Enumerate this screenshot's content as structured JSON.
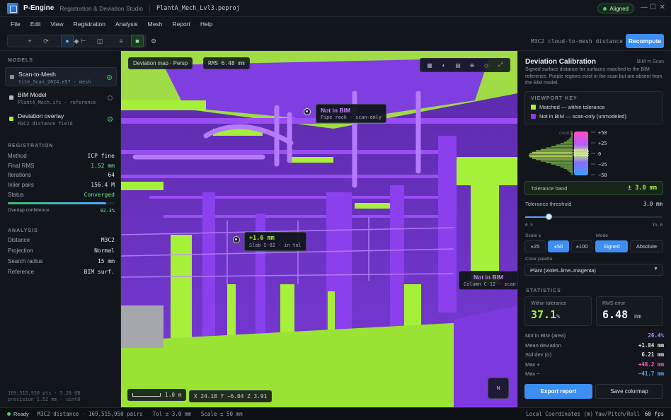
{
  "app": {
    "name": "P-Engine",
    "subtitle": "Registration & Deviation Studio",
    "file": "PlantA_Mech_Lvl3.peproj",
    "status_badge": "Aligned",
    "colors": {
      "accent": "#3d8ef0",
      "match": "#a6f03a",
      "missing": "#8c3cf0",
      "ok": "#4ad46a"
    }
  },
  "window_controls": {
    "minimize": "—",
    "maximize": "☐",
    "close": "✕"
  },
  "menu": [
    "File",
    "Edit",
    "View",
    "Registration",
    "Analysis",
    "Mesh",
    "Report",
    "Help"
  ],
  "toolbar": {
    "icons": [
      "select-icon",
      "move-icon",
      "rotate-icon",
      "point-icon",
      "measure-icon",
      "section-icon",
      "layers-icon",
      "mesh-icon",
      "settings-icon"
    ],
    "glyphs": [
      "◆",
      "+",
      "⟳",
      "●",
      "⊢",
      "◫",
      "≡",
      "■",
      "⚙"
    ],
    "metric": "M3C2 cloud-to-mesh distance",
    "recompute": "Recompute"
  },
  "left": {
    "models_title": "MODELS",
    "models": [
      {
        "name": "Scan-to-Mesh",
        "meta": "Site_Scan_2024.e57 · mesh",
        "color": "#8a8f96",
        "active": true
      },
      {
        "name": "BIM Model",
        "meta": "PlantA_Mech.ifc · reference",
        "color": "#b7bcc3",
        "active": false
      },
      {
        "name": "Deviation overlay",
        "meta": "M3C2 distance field",
        "color": "#a6f03a",
        "active": true
      }
    ],
    "registration_title": "REGISTRATION",
    "registration": [
      {
        "k": "Method",
        "v": "ICP fine"
      },
      {
        "k": "Final RMS",
        "v": "1.52 mm",
        "hl": true
      },
      {
        "k": "Iterations",
        "v": "64"
      },
      {
        "k": "Inlier pairs",
        "v": "156.4 M"
      },
      {
        "k": "Status",
        "v": "Converged",
        "hl": true
      }
    ],
    "overlap_label": "Overlap confidence",
    "overlap_value": "92.3%",
    "overlap_fraction": 0.923,
    "analysis_title": "ANALYSIS",
    "analysis": [
      {
        "k": "Distance",
        "v": "M3C2"
      },
      {
        "k": "Projection",
        "v": "Normal"
      },
      {
        "k": "Search radius",
        "v": "15 mm"
      },
      {
        "k": "Reference",
        "v": "BIM surf."
      }
    ],
    "footer1": "169,515,950 pts · 5.28 GB",
    "footer2": "precision 1.52 mm · uint8"
  },
  "viewport": {
    "mode": "Deviation map · Persp",
    "rms": "RMS 6.48 mm",
    "tool_glyphs": [
      "▦",
      "◐",
      "▤",
      "⊕",
      "◇",
      "⤢"
    ],
    "callout1": {
      "title": "Not in BIM",
      "sub": "Pipe rack · scan-only"
    },
    "callout2": {
      "title": "+1.6 mm",
      "sub": "Slab S-02 · in tol"
    },
    "callout3": {
      "title": "Not in BIM",
      "sub": "Column C-12 · scan-only"
    },
    "scale": "1.0 m",
    "coords": "X 24.18  Y −6.04  Z 3.91",
    "compass": "N"
  },
  "right": {
    "title": "Deviation Calibration",
    "mode": "BIM ⇆ Scan",
    "desc": "Signed surface distance for surfaces matched to the BIM reference. Purple regions exist in the scan but are absent from the BIM model.",
    "key_title": "VIEWPORT KEY",
    "key": [
      {
        "label": "Matched — within tolerance",
        "color": "#a6f03a"
      },
      {
        "label": "Not in BIM — scan-only (unmodeled)",
        "color": "#8c3cf0"
      }
    ],
    "hist_label": "count",
    "ticks": [
      "+50",
      "+25",
      "0",
      "−25",
      "−50"
    ],
    "tol_band_label": "Tolerance band",
    "tol_band_value": "± 3.0 mm",
    "threshold_label": "Tolerance threshold",
    "threshold_value": "3.0 mm",
    "threshold_min": "0.5",
    "threshold_max": "15.0",
    "threshold_fraction": 0.172,
    "scale_label": "Scale ±",
    "scales": [
      "±25",
      "±50",
      "±100"
    ],
    "scale_selected": 1,
    "mode_label": "Mode",
    "modes": [
      "Signed",
      "Absolute"
    ],
    "mode_selected": 0,
    "palette_label": "Color palette",
    "palette": "Plant (violet–lime–magenta)",
    "stats_title": "STATISTICS",
    "within_label": "Within tolerance",
    "within_value": "37.1",
    "within_unit": "%",
    "rms_label": "RMS error",
    "rms_value": "6.48",
    "rms_unit": "mm",
    "stats": [
      {
        "k": "Not in BIM (area)",
        "v": "26.4%",
        "color": "#c08cff"
      },
      {
        "k": "Mean deviation",
        "v": "+1.84 mm",
        "color": "#e6ebf1"
      },
      {
        "k": "Std dev (σ)",
        "v": "6.21 mm",
        "color": "#e6ebf1"
      },
      {
        "k": "Max +",
        "v": "+48.2 mm",
        "color": "#ff5fc8"
      },
      {
        "k": "Max −",
        "v": "−41.7 mm",
        "color": "#5aa8ff"
      }
    ],
    "export": "Export report",
    "save": "Save colormap"
  },
  "status": {
    "ready": "Ready",
    "pairs": "M3C2 distance · 169,515,950 pairs",
    "tol": "Tol ± 3.0 mm",
    "scale": "Scale ± 50 mm",
    "coords": "Local Coordinates (m)",
    "ypr": "Yaw/Pitch/Roll",
    "fps": "60 fps"
  }
}
